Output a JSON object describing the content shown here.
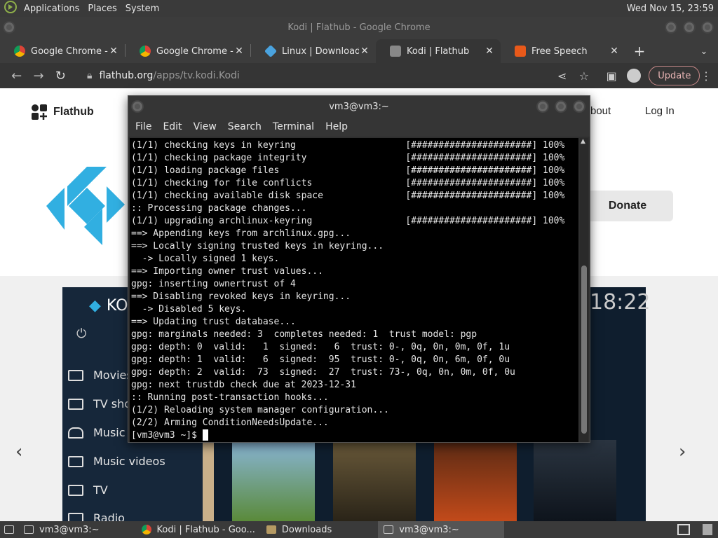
{
  "system_panel": {
    "menus": [
      "Applications",
      "Places",
      "System"
    ],
    "clock": "Wed Nov 15, 23:59"
  },
  "chrome": {
    "window_title": "Kodi | Flathub - Google Chrome",
    "tabs": [
      {
        "label": "Google Chrome - Th",
        "icon": "chrome-icon",
        "active": false
      },
      {
        "label": "Google Chrome - Th",
        "icon": "chrome-icon",
        "active": false
      },
      {
        "label": "Linux | Downloads |",
        "icon": "diamond-icon",
        "active": false
      },
      {
        "label": "Kodi | Flathub",
        "icon": "puzzle-icon",
        "active": true
      },
      {
        "label": "Free Speech",
        "icon": "brave-icon",
        "active": false
      }
    ],
    "url_domain": "flathub.org",
    "url_path": "/apps/tv.kodi.Kodi",
    "update_label": "Update"
  },
  "flathub": {
    "brand": "Flathub",
    "about": "bout",
    "login": "Log In",
    "donate": "Donate",
    "kodi_title": "KO",
    "kodi_time": "18:22",
    "kodi_menu": [
      "Movies",
      "TV sho",
      "Music",
      "Music videos",
      "TV",
      "Radio"
    ]
  },
  "terminal": {
    "title": "vm3@vm3:~",
    "menu": [
      "File",
      "Edit",
      "View",
      "Search",
      "Terminal",
      "Help"
    ],
    "lines": [
      "(1/1) checking keys in keyring                    [######################] 100%",
      "(1/1) checking package integrity                  [######################] 100%",
      "(1/1) loading package files                       [######################] 100%",
      "(1/1) checking for file conflicts                 [######################] 100%",
      "(1/1) checking available disk space               [######################] 100%",
      ":: Processing package changes...",
      "(1/1) upgrading archlinux-keyring                 [######################] 100%",
      "==> Appending keys from archlinux.gpg...",
      "==> Locally signing trusted keys in keyring...",
      "  -> Locally signed 1 keys.",
      "==> Importing owner trust values...",
      "gpg: inserting ownertrust of 4",
      "==> Disabling revoked keys in keyring...",
      "  -> Disabled 5 keys.",
      "==> Updating trust database...",
      "gpg: marginals needed: 3  completes needed: 1  trust model: pgp",
      "gpg: depth: 0  valid:   1  signed:   6  trust: 0-, 0q, 0n, 0m, 0f, 1u",
      "gpg: depth: 1  valid:   6  signed:  95  trust: 0-, 0q, 0n, 6m, 0f, 0u",
      "gpg: depth: 2  valid:  73  signed:  27  trust: 73-, 0q, 0n, 0m, 0f, 0u",
      "gpg: next trustdb check due at 2023-12-31",
      ":: Running post-transaction hooks...",
      "(1/2) Reloading system manager configuration...",
      "(2/2) Arming ConditionNeedsUpdate..."
    ],
    "prompt": "[vm3@vm3 ~]$ "
  },
  "taskbar": {
    "items": [
      {
        "label": "vm3@vm3:~",
        "active": false
      },
      {
        "label": "Kodi | Flathub - Goo...",
        "active": false
      },
      {
        "label": "Downloads",
        "active": false
      },
      {
        "label": "vm3@vm3:~",
        "active": true
      }
    ]
  }
}
